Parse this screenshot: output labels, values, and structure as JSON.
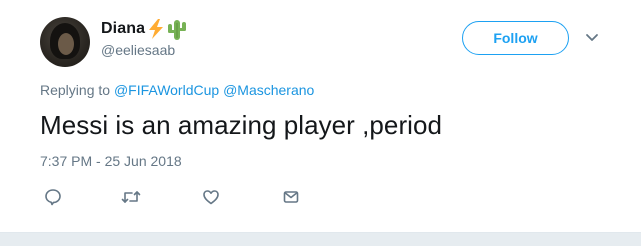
{
  "tweet": {
    "display_name": "Diana",
    "name_emojis": [
      "lightning-emoji",
      "cactus-emoji"
    ],
    "handle": "@eeliesaab",
    "follow_label": "Follow",
    "reply_prefix": "Replying to",
    "reply_mentions": [
      "@FIFAWorldCup",
      "@Mascherano"
    ],
    "text": "Messi is an amazing player ,period",
    "timestamp": "7:37 PM - 25 Jun 2018",
    "actions": [
      "reply-icon",
      "retweet-icon",
      "like-icon",
      "direct-message-icon"
    ]
  },
  "colors": {
    "accent": "#1da1f2",
    "mention": "#1b95e0",
    "text": "#14171a",
    "muted": "#657786"
  }
}
